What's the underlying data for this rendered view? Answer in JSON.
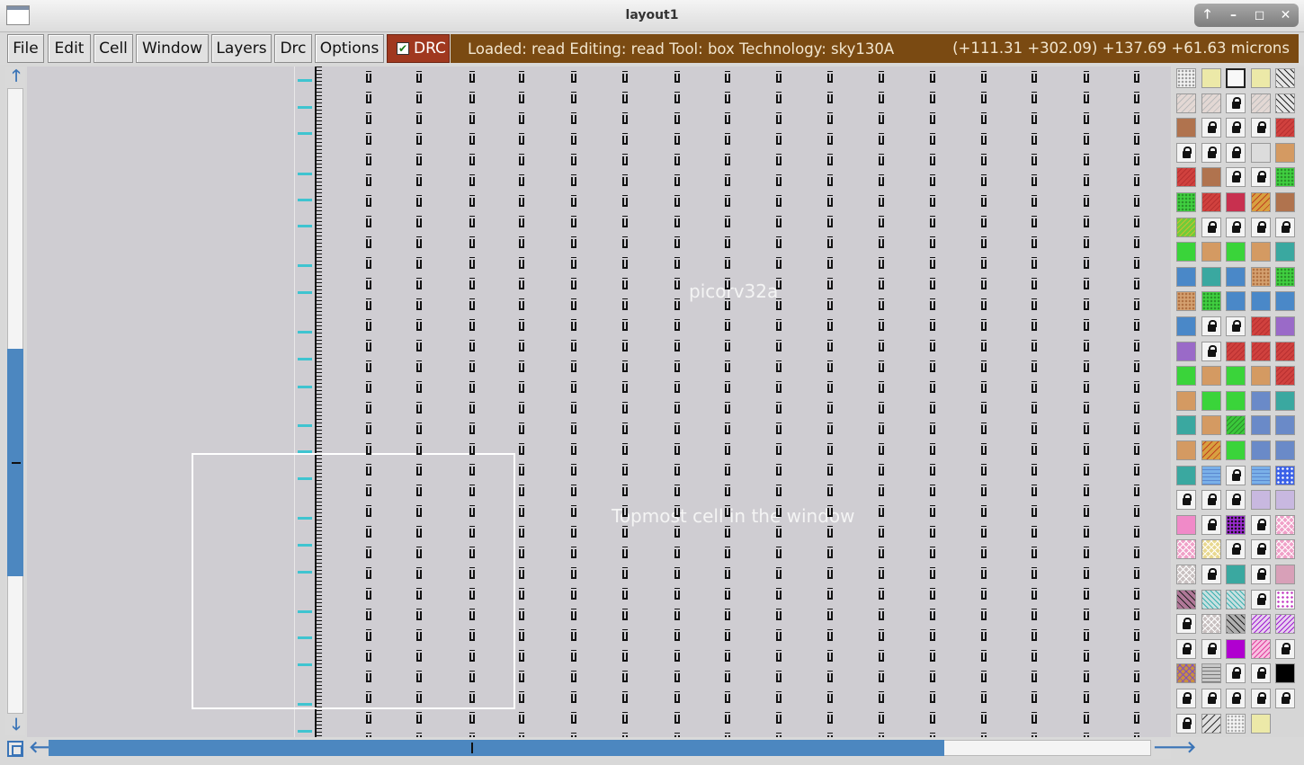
{
  "window": {
    "title": "layout1",
    "controls": [
      "🡑",
      "–",
      "◻",
      "✕"
    ]
  },
  "menu": {
    "items": [
      "File",
      "Edit",
      "Cell",
      "Window",
      "Layers",
      "Drc",
      "Options"
    ],
    "drc_label": "DRC",
    "drc_checked": true
  },
  "status": {
    "text": "Loaded: read Editing: read Tool: box  Technology: sky130A",
    "coords": "(+111.31 +302.09) +137.69 +61.63 microns"
  },
  "canvas": {
    "cell_name": "picorv32a",
    "note": "Topmost cell in the window"
  },
  "scroll": {
    "vertical_position_fraction": 0.42,
    "vertical_visible_fraction": 0.36,
    "horizontal_position_fraction": 0.0,
    "horizontal_visible_fraction": 0.81
  },
  "colors": {
    "accent_blue": "#4c87c0",
    "status_brown": "#7a4a12",
    "drc_red": "#a0381f",
    "canvas_bg": "#cfcdd2",
    "cyan_marks": "#3fc4d0"
  },
  "layer_palette": [
    [
      "dots-white",
      "yellow-pale",
      "outline-white",
      "yellow-pale",
      "diag-black"
    ],
    [
      "diag-pale",
      "diag-pale",
      "lock",
      "diag-pale",
      "diag-black"
    ],
    [
      "brown",
      "lock",
      "lock",
      "lock",
      "red"
    ],
    [
      "lock",
      "lock",
      "lock",
      "gray-light",
      "tan"
    ],
    [
      "red",
      "brown",
      "lock",
      "lock",
      "green-dots"
    ],
    [
      "green-dots",
      "red",
      "crimson",
      "orange-diag",
      "brown"
    ],
    [
      "green-yellow",
      "lock",
      "lock",
      "lock",
      "lock"
    ],
    [
      "green",
      "tan",
      "green",
      "tan",
      "teal-x"
    ],
    [
      "blue-x",
      "teal-x",
      "blue-x",
      "tan-dots",
      "green-dots"
    ],
    [
      "tan-dots",
      "green-dots",
      "blue-x",
      "blue-x",
      "blue-x"
    ],
    [
      "blue-x",
      "lock",
      "lock",
      "red",
      "purple-x"
    ],
    [
      "purple-x",
      "lock",
      "red",
      "red",
      "red"
    ],
    [
      "green",
      "tan",
      "green",
      "tan",
      "red"
    ],
    [
      "tan",
      "green",
      "green",
      "navy-x",
      "teal-x"
    ],
    [
      "teal-x",
      "tan",
      "green-diag",
      "navy-x",
      "navy-x"
    ],
    [
      "tan",
      "orange-diag",
      "green",
      "navy-x",
      "navy-x"
    ],
    [
      "teal-x",
      "blue-waves",
      "lock",
      "blue-waves",
      "blue-checks"
    ],
    [
      "lock",
      "lock",
      "lock",
      "lavender",
      "lavender"
    ],
    [
      "pink",
      "lock",
      "purple-dense",
      "lock",
      "pink-cross"
    ],
    [
      "pink-cross",
      "yellow-cross",
      "lock",
      "lock",
      "pink-cross"
    ],
    [
      "gray-cross",
      "lock",
      "teal-x",
      "lock",
      "mauve"
    ],
    [
      "mauve-diag",
      "teal-diag",
      "teal-diag",
      "lock",
      "pink-dots"
    ],
    [
      "lock",
      "gray-cross",
      "gray-diag",
      "purple-diag",
      "purple-diag"
    ],
    [
      "lock",
      "lock",
      "magenta",
      "pink-diag",
      "lock"
    ],
    [
      "gold-cross",
      "gray-waves",
      "lock",
      "lock",
      "black"
    ],
    [
      "lock",
      "lock",
      "lock",
      "lock",
      "lock"
    ],
    [
      "lock",
      "diag-gray",
      "white-dots",
      "yellow-pale",
      ""
    ]
  ]
}
